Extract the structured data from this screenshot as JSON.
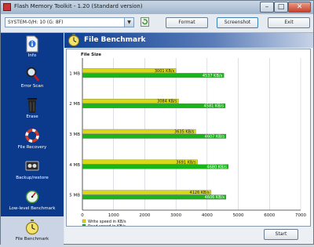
{
  "window": {
    "title": "Flash Memory Toolkit - 1.20 (Standard version)"
  },
  "toolbar": {
    "drive_value": "SYSTEM-0/H: 10 (G: 8F)",
    "format_label": "Format",
    "screenshot_label": "Screenshot",
    "exit_label": "Exit"
  },
  "sidebar": {
    "items": [
      {
        "label": "Info",
        "icon": "info-icon"
      },
      {
        "label": "Error Scan",
        "icon": "magnifier-icon"
      },
      {
        "label": "Erase",
        "icon": "trash-icon"
      },
      {
        "label": "File Recovery",
        "icon": "lifebuoy-icon"
      },
      {
        "label": "Backup/restore",
        "icon": "tape-icon"
      },
      {
        "label": "Low-level Benchmark",
        "icon": "gauge-icon"
      },
      {
        "label": "File Benchmark",
        "icon": "stopwatch-icon",
        "active": true
      }
    ]
  },
  "main": {
    "title": "File Benchmark",
    "start_label": "Start"
  },
  "colors": {
    "read": "#d8d817",
    "write": "#19b419",
    "sidebar": "#0b3a8c"
  },
  "chart_data": {
    "type": "bar",
    "orientation": "horizontal",
    "ylabel": "File Size",
    "categories": [
      "1 MB",
      "2 MB",
      "3 MB",
      "4 MB",
      "5 MB"
    ],
    "series": [
      {
        "name": "Write speed in KB/s",
        "values": [
          3001,
          3084,
          3635,
          3691,
          4126
        ],
        "labels": [
          "3001 KB/s",
          "3084 KB/s",
          "3635 KB/s",
          "3691 KB/s",
          "4126 KB/s"
        ],
        "color": "#d8d817"
      },
      {
        "name": "Read speed in KB/s",
        "values": [
          4537,
          4581,
          4607,
          4680,
          4606
        ],
        "labels": [
          "4537 KB/s",
          "4581 KB/s",
          "4607 KB/s",
          "4680 KB/s",
          "4606 KB/s"
        ],
        "color": "#19b419"
      }
    ],
    "xlim": [
      0,
      7000
    ],
    "xticks": [
      0,
      1000,
      2000,
      3000,
      4000,
      5000,
      6000,
      7000
    ],
    "grid": true,
    "legend": "bottom-left"
  }
}
